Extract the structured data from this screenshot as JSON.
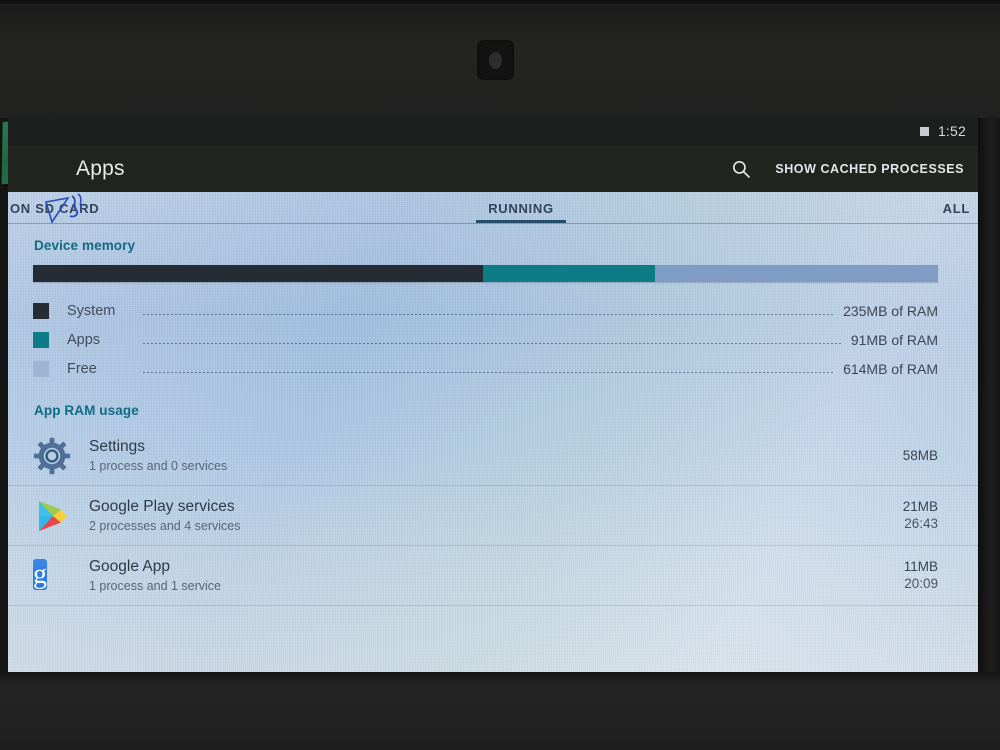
{
  "statusbar": {
    "time": "1:52",
    "icon": "square-indicator-icon"
  },
  "actionbar": {
    "title": "Apps",
    "search_icon": "search-icon",
    "cached_label": "SHOW CACHED PROCESSES"
  },
  "tabs": [
    {
      "label": "ON SD CARD",
      "active": false
    },
    {
      "label": "RUNNING",
      "active": true
    },
    {
      "label": "ALL",
      "active": false
    }
  ],
  "device_memory": {
    "title": "Device memory",
    "segments": [
      {
        "name": "System",
        "color": "#262c34",
        "percent": 49.7
      },
      {
        "name": "Apps",
        "color": "#0e7c86",
        "percent": 19.0
      },
      {
        "name": "Free",
        "color": "#7e9cc4",
        "percent": 31.3
      }
    ],
    "legend": [
      {
        "label": "System",
        "value": "235MB of RAM",
        "color": "#262c34"
      },
      {
        "label": "Apps",
        "value": "91MB of RAM",
        "color": "#0e7c86"
      },
      {
        "label": "Free",
        "value": "614MB of RAM",
        "color": "#7e9cc4"
      }
    ]
  },
  "app_ram_usage": {
    "title": "App RAM usage",
    "apps": [
      {
        "icon": "settings-gear-icon",
        "name": "Settings",
        "subtitle": "1 process and 0 services",
        "memory": "58MB",
        "time": ""
      },
      {
        "icon": "google-play-services-icon",
        "name": "Google Play services",
        "subtitle": "2 processes and 4 services",
        "memory": "21MB",
        "time": "26:43"
      },
      {
        "icon": "google-app-icon",
        "name": "Google App",
        "subtitle": "1 process and 1 service",
        "memory": "11MB",
        "time": "20:09"
      }
    ]
  },
  "navbar": [
    {
      "name": "volume-down-icon",
      "glyph": "◁-"
    },
    {
      "name": "back-icon",
      "glyph": "◁"
    },
    {
      "name": "home-icon",
      "glyph": "◯"
    },
    {
      "name": "recents-icon",
      "glyph": "□"
    },
    {
      "name": "volume-up-icon",
      "glyph": "◁+"
    }
  ]
}
